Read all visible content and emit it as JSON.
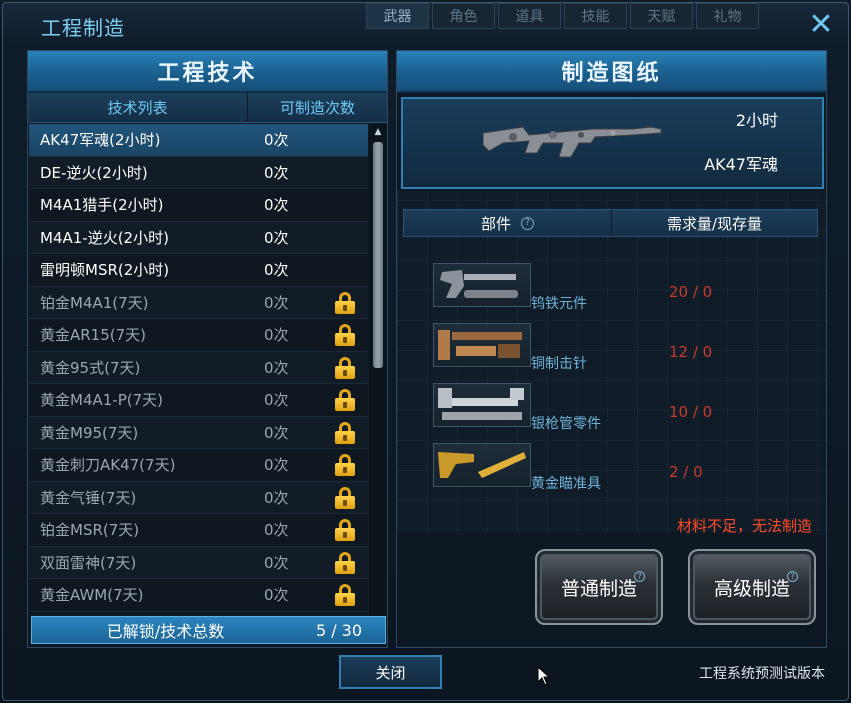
{
  "top_tabs": [
    "武器",
    "角色",
    "道具",
    "技能",
    "天赋",
    "礼物"
  ],
  "window": {
    "title": "工程制造",
    "close_icon": "close-icon"
  },
  "left_panel": {
    "header": "工程技术",
    "columns": {
      "name": "技术列表",
      "count": "可制造次数"
    },
    "items": [
      {
        "name": "AK47军魂(2小时)",
        "count": "0次",
        "locked": false,
        "selected": true
      },
      {
        "name": "DE-逆火(2小时)",
        "count": "0次",
        "locked": false
      },
      {
        "name": "M4A1猎手(2小时)",
        "count": "0次",
        "locked": false
      },
      {
        "name": "M4A1-逆火(2小时)",
        "count": "0次",
        "locked": false
      },
      {
        "name": "雷明顿MSR(2小时)",
        "count": "0次",
        "locked": false
      },
      {
        "name": "铂金M4A1(7天)",
        "count": "0次",
        "locked": true
      },
      {
        "name": "黄金AR15(7天)",
        "count": "0次",
        "locked": true
      },
      {
        "name": "黄金95式(7天)",
        "count": "0次",
        "locked": true
      },
      {
        "name": "黄金M4A1-P(7天)",
        "count": "0次",
        "locked": true
      },
      {
        "name": "黄金M95(7天)",
        "count": "0次",
        "locked": true
      },
      {
        "name": "黄金刺刀AK47(7天)",
        "count": "0次",
        "locked": true
      },
      {
        "name": "黄金气锤(7天)",
        "count": "0次",
        "locked": true
      },
      {
        "name": "铂金MSR(7天)",
        "count": "0次",
        "locked": true
      },
      {
        "name": "双面雷神(7天)",
        "count": "0次",
        "locked": true
      },
      {
        "name": "黄金AWM(7天)",
        "count": "0次",
        "locked": true
      }
    ],
    "footer": {
      "label": "已解锁/技术总数",
      "value": "5 / 30"
    }
  },
  "right_panel": {
    "header": "制造图纸",
    "weapon": {
      "time": "2小时",
      "name": "AK47军魂"
    },
    "parts_columns": {
      "part": "部件",
      "need": "需求量/现存量"
    },
    "parts": [
      {
        "name": "钨铁元件",
        "qty": "20 / 0"
      },
      {
        "name": "铜制击针",
        "qty": "12 / 0"
      },
      {
        "name": "银枪管零件",
        "qty": "10 / 0"
      },
      {
        "name": "黄金瞄准具",
        "qty": "2 / 0"
      }
    ],
    "warning": "材料不足，无法制造",
    "buttons": {
      "normal": "普通制造",
      "advanced": "高级制造"
    }
  },
  "bottom": {
    "close": "关闭",
    "version": "工程系统预测试版本"
  },
  "colors": {
    "accent": "#2a82b8",
    "warning": "#ff4a24",
    "qty": "#c83a2a",
    "lock": "#e3a81a"
  }
}
